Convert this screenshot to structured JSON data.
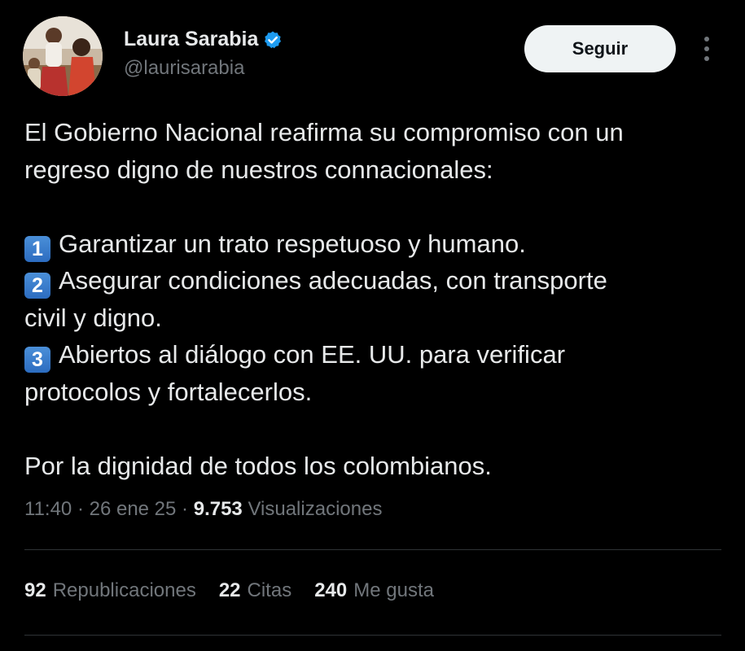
{
  "author": {
    "display_name": "Laura Sarabia",
    "handle": "@laurisarabia",
    "verified": true
  },
  "follow_button": {
    "label": "Seguir"
  },
  "tweet": {
    "intro_line1": "El Gobierno Nacional reafirma su compromiso con un",
    "intro_line2": "regreso digno de nuestros connacionales:",
    "items": [
      {
        "key": "1",
        "line1": "Garantizar un trato respetuoso y humano."
      },
      {
        "key": "2",
        "line1": "Asegurar condiciones adecuadas, con transporte",
        "line2": "civil y digno."
      },
      {
        "key": "3",
        "line1": "Abiertos al diálogo con EE. UU. para verificar",
        "line2": "protocolos y fortalecerlos."
      }
    ],
    "closing": "Por la dignidad de todos los colombianos."
  },
  "meta": {
    "time": "11:40",
    "separator": " · ",
    "date": "26 ene 25",
    "views_count": "9.753",
    "views_label": "Visualizaciones"
  },
  "stats": {
    "reposts_count": "92",
    "reposts_label": "Republicaciones",
    "quotes_count": "22",
    "quotes_label": "Citas",
    "likes_count": "240",
    "likes_label": "Me gusta"
  },
  "colors": {
    "background": "#000000",
    "text_primary": "#e7e9ea",
    "text_secondary": "#71767b",
    "verified_badge": "#1d9bf0",
    "follow_button_bg": "#eff3f4",
    "divider": "#2f3336"
  },
  "icons": {
    "verified": "verified-badge-icon",
    "more": "more-vertical-icon"
  }
}
